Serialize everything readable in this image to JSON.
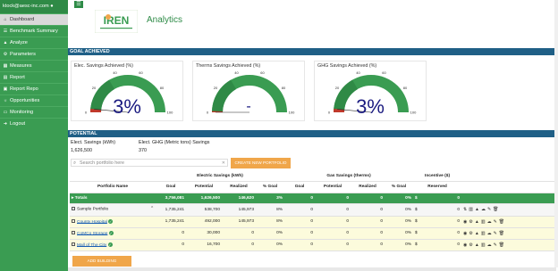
{
  "sidebar": {
    "user": "ktock@aesc-inc.com",
    "items": [
      {
        "label": "Dashboard",
        "icon": "home-icon"
      },
      {
        "label": "Benchmark Summary",
        "icon": "list-icon"
      },
      {
        "label": "Analyze",
        "icon": "chart-icon"
      },
      {
        "label": "Parameters",
        "icon": "gear-icon"
      },
      {
        "label": "Measures",
        "icon": "ruler-icon"
      },
      {
        "label": "Report",
        "icon": "file-icon"
      },
      {
        "label": "Report Repo",
        "icon": "folder-icon"
      },
      {
        "label": "Opportunities",
        "icon": "lightbulb-icon"
      },
      {
        "label": "Monitoring",
        "icon": "monitor-icon"
      },
      {
        "label": "Logout",
        "icon": "logout-icon"
      }
    ]
  },
  "header": {
    "title": "Analytics",
    "logo_text": "IREN"
  },
  "goal_section": {
    "label": "GOAL ACHIEVED"
  },
  "gauges": [
    {
      "title": "Elec. Savings Achieved (%)",
      "value": "3%",
      "fraction": 0.03
    },
    {
      "title": "Therms Savings Achieved (%)",
      "value": "-",
      "fraction": 0
    },
    {
      "title": "GHG Savings Achieved (%)",
      "value": "3%",
      "fraction": 0.03
    }
  ],
  "gauge_ticks": [
    "0",
    "20",
    "40",
    "60",
    "80",
    "100"
  ],
  "potential_section": {
    "label": "POTENTIAL"
  },
  "potential": {
    "elec_label": "Elect. Savings (kWh)",
    "elec_value": "1,626,500",
    "ghg_label": "Elect. GHG (Metric tons) Savings",
    "ghg_value": "370"
  },
  "search": {
    "placeholder": "Search portfolio here"
  },
  "create_button": "CREATE NEW PORTFOLIO",
  "add_button": "ADD BUILDING",
  "table": {
    "groups": {
      "elec": "Electric Savings (kWh)",
      "gas": "Gas Savings (therms)",
      "incentive": "Incentive ($)"
    },
    "headers": [
      "Portfolio Name",
      "Goal",
      "Potential",
      "Realized",
      "% Goal",
      "Goal",
      "Potential",
      "Realized",
      "% Goal",
      "Reserved",
      ""
    ],
    "totals": {
      "name": "Totals",
      "cells": [
        "3,756,081",
        "1,626,500",
        "146,620",
        "3%",
        "0",
        "0",
        "0",
        "0%",
        "$",
        "0"
      ]
    },
    "portfolio": {
      "name": "Sample Portfolio",
      "cells": [
        "1,735,241",
        "538,700",
        "145,973",
        "8%",
        "0",
        "0",
        "0",
        "0%",
        "$",
        "0"
      ]
    },
    "buildings": [
      {
        "name": "County Hospital",
        "cells": [
          "1,735,241",
          "492,000",
          "145,973",
          "8%",
          "0",
          "0",
          "0",
          "0%",
          "$",
          "0"
        ]
      },
      {
        "name": "CoMCo Storage",
        "cells": [
          "0",
          "30,000",
          "0",
          "0%",
          "0",
          "0",
          "0",
          "0%",
          "$",
          "0"
        ]
      },
      {
        "name": "Mall of The City",
        "cells": [
          "0",
          "16,700",
          "0",
          "0%",
          "0",
          "0",
          "0",
          "0%",
          "$",
          "0"
        ]
      }
    ]
  }
}
